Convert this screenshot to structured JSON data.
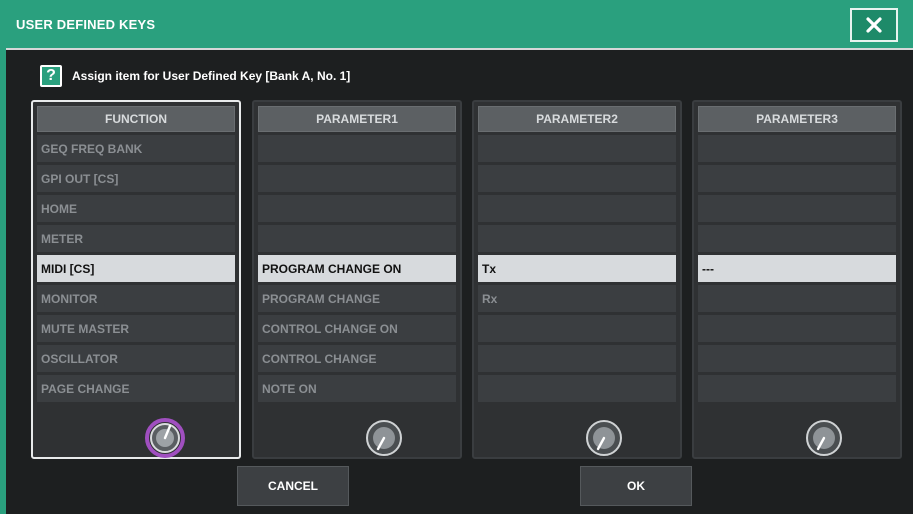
{
  "window": {
    "title": "USER DEFINED KEYS",
    "close_icon": "close-icon",
    "accent_color": "#2aa07e"
  },
  "help": {
    "icon_label": "?",
    "text": "Assign item for User Defined Key [Bank A, No. 1]"
  },
  "columns": [
    {
      "header": "FUNCTION",
      "rows": [
        "GEQ FREQ BANK",
        "GPI OUT [CS]",
        "HOME",
        "METER",
        "MIDI [CS]",
        "MONITOR",
        "MUTE MASTER",
        "OSCILLATOR",
        "PAGE CHANGE"
      ],
      "selected": "MIDI [CS]"
    },
    {
      "header": "PARAMETER1",
      "rows": [
        "",
        "",
        "",
        "",
        "PROGRAM CHANGE ON",
        "PROGRAM CHANGE",
        "CONTROL CHANGE ON",
        "CONTROL CHANGE",
        "NOTE ON"
      ],
      "selected": "PROGRAM CHANGE ON"
    },
    {
      "header": "PARAMETER2",
      "rows": [
        "",
        "",
        "",
        "",
        "Tx",
        "Rx",
        "",
        "",
        ""
      ],
      "selected": "Tx"
    },
    {
      "header": "PARAMETER3",
      "rows": [
        "",
        "",
        "",
        "",
        "---",
        "",
        "",
        "",
        ""
      ],
      "selected": "---"
    }
  ],
  "knobs": {
    "active_color": "#a04fc0",
    "icon": "rotary-knob-icon"
  },
  "buttons": {
    "cancel": "CANCEL",
    "ok": "OK"
  }
}
